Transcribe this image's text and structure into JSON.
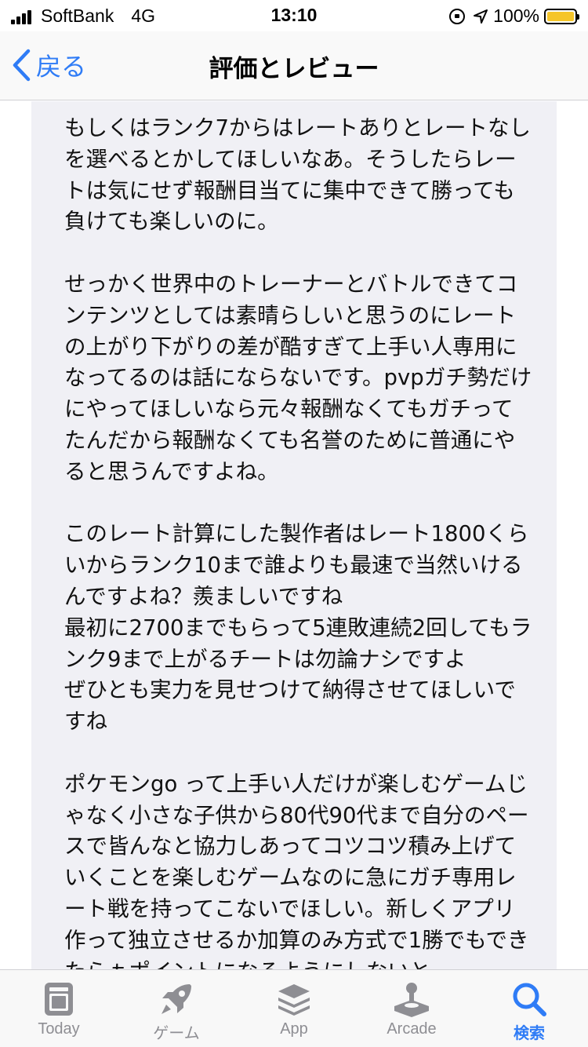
{
  "status_bar": {
    "carrier": "SoftBank",
    "network": "4G",
    "time": "13:10",
    "battery_percent": "100%"
  },
  "nav": {
    "back_label": "戻る",
    "title": "評価とレビュー"
  },
  "review": {
    "paragraphs": [
      "もしくはランク7からはレートありとレートなしを選べるとかしてほしいなあ。そうしたらレートは気にせず報酬目当てに集中できて勝っても負けても楽しいのに。",
      "せっかく世界中のトレーナーとバトルできてコンテンツとしては素晴らしいと思うのにレートの上がり下がりの差が酷すぎて上手い人専用になってるのは話にならないです。pvpガチ勢だけにやってほしいなら元々報酬なくてもガチってたんだから報酬なくても名誉のために普通にやると思うんですよね。",
      "このレート計算にした製作者はレート1800くらいからランク10まで誰よりも最速で当然いけるんですよね？羨ましいですね\n最初に2700までもらって5連敗連続2回してもランク9まで上がるチートは勿論ナシですよ\nぜひとも実力を見せつけて納得させてほしいですね",
      "ポケモンgo って上手い人だけが楽しむゲームじゃなく小さな子供から80代90代まで自分のペースで皆んなと協力しあってコツコツ積み上げていくことを楽しむゲームなのに急にガチ専用レート戦を持ってこないでほしい。新しくアプリ作って独立させるか加算のみ方式で1勝でもできたらｔポイントになるようにしないと"
    ]
  },
  "tab_bar": {
    "tabs": [
      {
        "label": "Today",
        "icon": "today-icon",
        "active": false
      },
      {
        "label": "ゲーム",
        "icon": "rocket-icon",
        "active": false
      },
      {
        "label": "App",
        "icon": "layers-icon",
        "active": false
      },
      {
        "label": "Arcade",
        "icon": "joystick-icon",
        "active": false
      },
      {
        "label": "検索",
        "icon": "search-icon",
        "active": true
      }
    ]
  },
  "colors": {
    "accent": "#2f7cf6",
    "tab_inactive": "#8e8e93",
    "content_background": "#f0f0f5",
    "battery": "#f5c52a"
  }
}
